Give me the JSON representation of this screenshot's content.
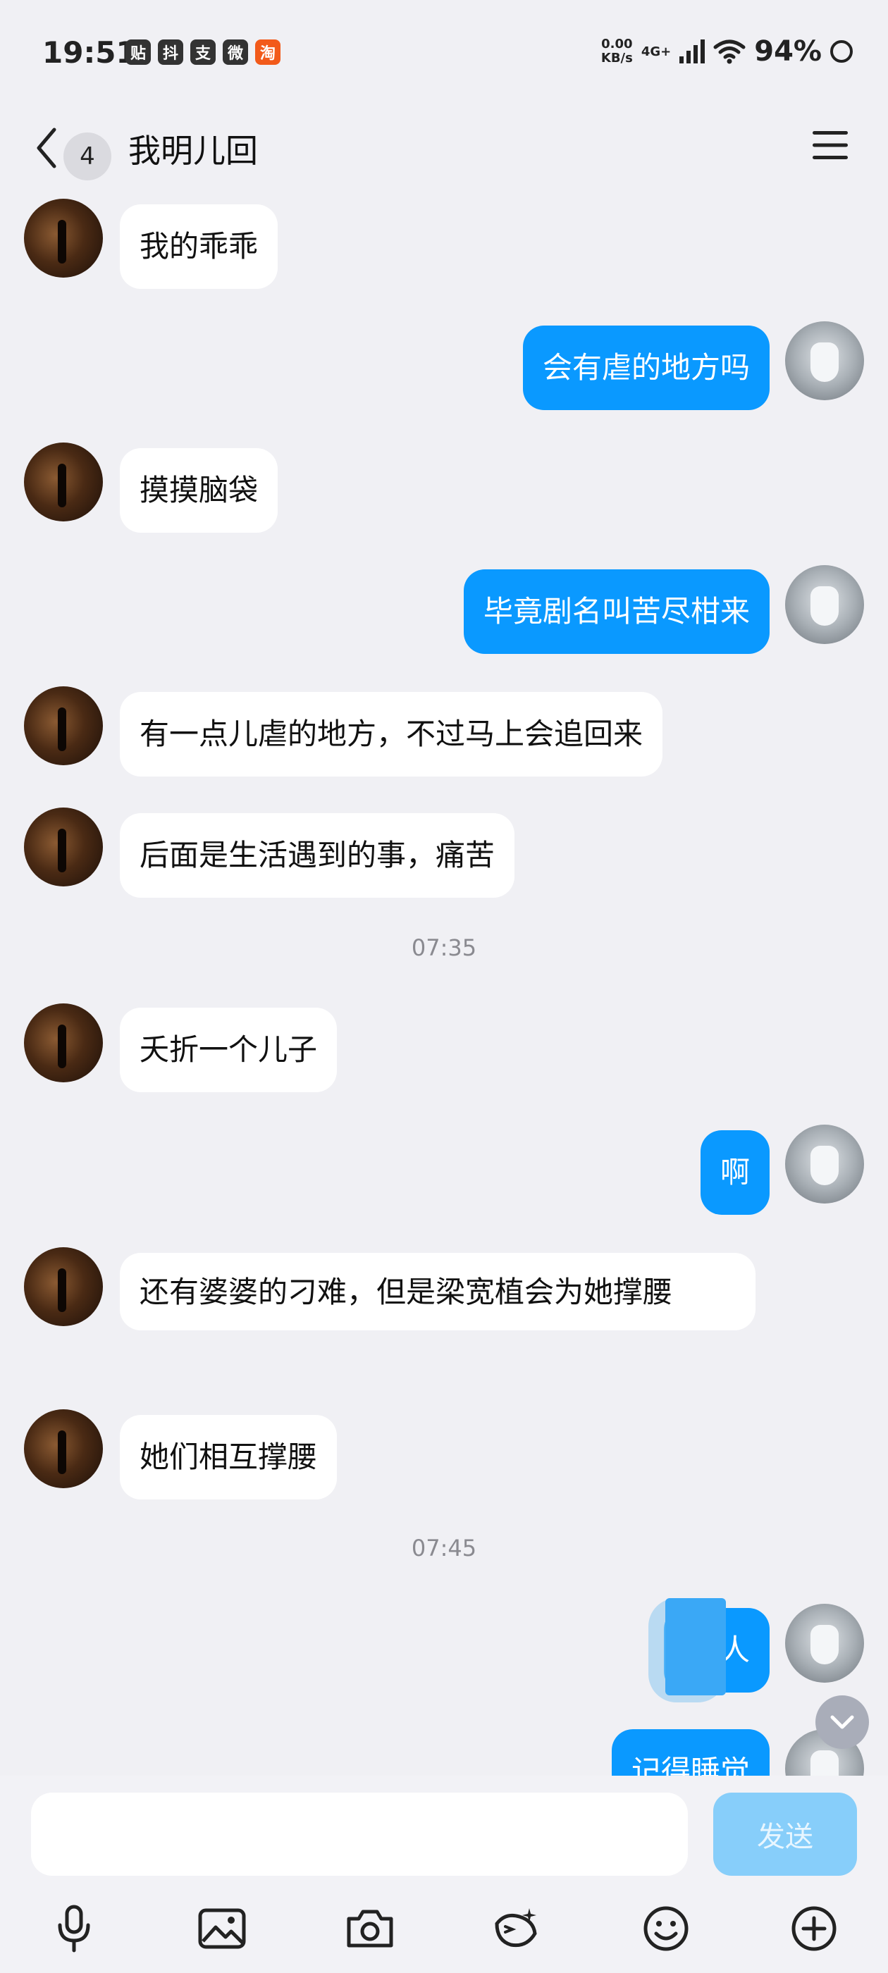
{
  "status_bar": {
    "time": "19:51",
    "notif_icons": [
      "贴",
      "抖",
      "支",
      "微",
      "淘"
    ],
    "net_speed_top": "0.00",
    "net_speed_bottom": "KB/s",
    "network": "4G+",
    "battery": "94%"
  },
  "header": {
    "unread_count": "4",
    "title": "我明儿回"
  },
  "messages": [
    {
      "from": "other",
      "text": "我的乖乖"
    },
    {
      "from": "self",
      "text": "会有虐的地方吗"
    },
    {
      "from": "other",
      "text": "摸摸脑袋"
    },
    {
      "from": "self",
      "text": "毕竟剧名叫苦尽柑来"
    },
    {
      "from": "other",
      "text": "有一点儿虐的地方，不过马上会追回来"
    },
    {
      "from": "other",
      "text": "后面是生活遇到的事，痛苦"
    },
    {
      "type": "time",
      "text": "07:35"
    },
    {
      "from": "other",
      "text": "夭折一个儿子"
    },
    {
      "from": "self",
      "text": "啊"
    },
    {
      "from": "other",
      "text": "还有婆婆的刁难，但是梁宽植会为她撑腰"
    },
    {
      "from": "other",
      "text": "她们相互撑腰"
    },
    {
      "type": "time",
      "text": "07:45"
    },
    {
      "from": "self",
      "text": "人"
    },
    {
      "from": "self",
      "text": "记得睡觉"
    }
  ],
  "input": {
    "placeholder": "",
    "send_label": "发送"
  },
  "toolbar": [
    "microphone-icon",
    "image-icon",
    "camera-icon",
    "sticker-icon",
    "emoji-icon",
    "plus-icon"
  ],
  "colors": {
    "background": "#f0f0f4",
    "self_bubble": "#0a99ff",
    "other_bubble": "#ffffff",
    "send_button": "#87cefa"
  }
}
